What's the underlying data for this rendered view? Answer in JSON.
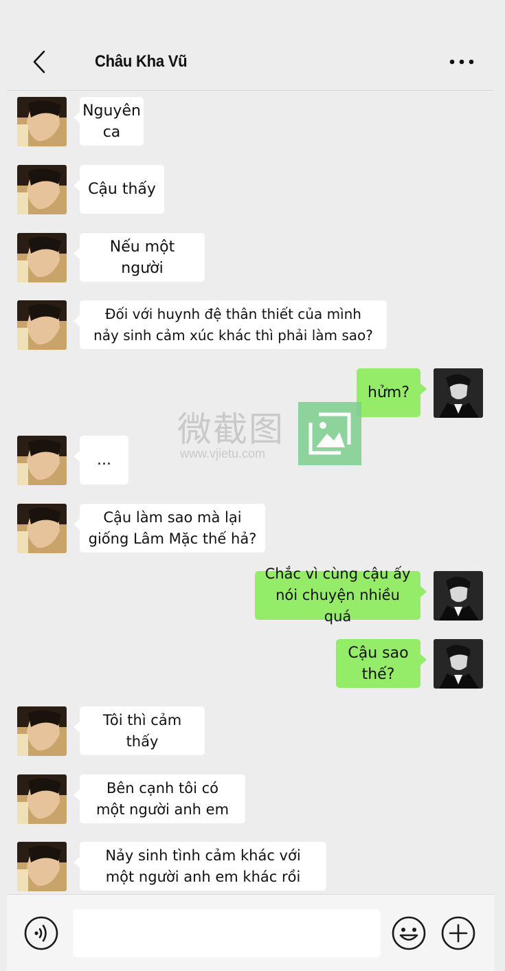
{
  "header": {
    "title": "Châu Kha Vũ",
    "back_icon": "chevron-left-icon",
    "more_icon": "more-dots-icon"
  },
  "watermark": {
    "text": "微截图",
    "url": "www.vjietu.com"
  },
  "messages": [
    {
      "side": "left",
      "text": "Nguyên\nca"
    },
    {
      "side": "left",
      "text": "Cậu thấy"
    },
    {
      "side": "left",
      "text": "Nếu một người"
    },
    {
      "side": "left",
      "text": "Đối với huynh đệ thân thiết của mình\nnảy sinh cảm xúc khác thì phải làm sao?"
    },
    {
      "side": "right",
      "text": "hửm?"
    },
    {
      "side": "left",
      "text": "..."
    },
    {
      "side": "left",
      "text": "Cậu làm sao mà lại\ngiống Lâm Mặc thế hả?"
    },
    {
      "side": "right",
      "text": "Chắc vì cùng cậu ấy\nnói chuyện nhiều quá"
    },
    {
      "side": "right",
      "text": "Cậu sao\nthế?"
    },
    {
      "side": "left",
      "text": "Tôi thì cảm thấy"
    },
    {
      "side": "left",
      "text": "Bên cạnh tôi có\nmột người anh em"
    },
    {
      "side": "left",
      "text": "Nảy sinh tình cảm khác với\nmột người anh em khác rồi"
    }
  ],
  "footer": {
    "input_value": "",
    "voice_icon": "voice-icon",
    "emoji_icon": "emoji-icon",
    "plus_icon": "plus-icon"
  },
  "colors": {
    "background": "#ededed",
    "bubble_self": "#95ec69",
    "bubble_other": "#ffffff"
  }
}
